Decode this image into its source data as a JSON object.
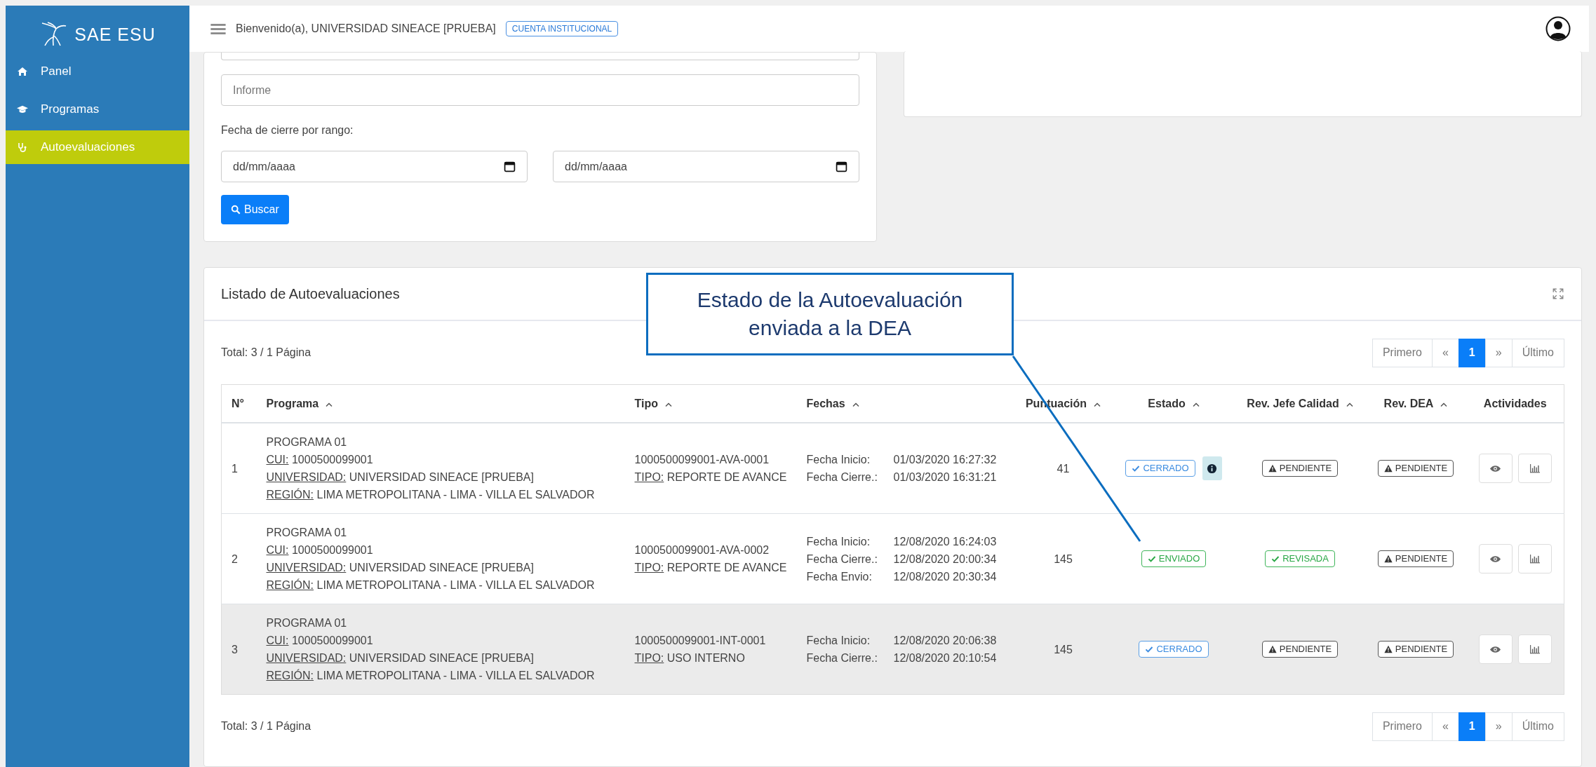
{
  "sidebar": {
    "logo": "SAE ESU",
    "items": [
      {
        "label": "Panel",
        "selected": false
      },
      {
        "label": "Programas",
        "selected": false
      },
      {
        "label": "Autoevaluaciones",
        "selected": true
      }
    ]
  },
  "header": {
    "welcome": "Bienvenido(a), UNIVERSIDAD SINEACE [PRUEBA]",
    "badge": "CUENTA INSTITUCIONAL"
  },
  "filters": {
    "informe_placeholder": "Informe",
    "range_label": "Fecha de cierre por rango:",
    "date_from_placeholder": "dd/mm/aaaa",
    "date_to_placeholder": "dd/mm/aaaa",
    "search_button": "Buscar"
  },
  "listing": {
    "title": "Listado de Autoevaluaciones",
    "total_top": "Total: 3 / 1 Página",
    "total_bottom": "Total: 3 / 1 Página",
    "pagination_top": [
      {
        "label": "Primero",
        "selected": false
      },
      {
        "label": "«",
        "selected": false
      },
      {
        "label": "1",
        "selected": true
      },
      {
        "label": "»",
        "selected": false
      },
      {
        "label": "Último",
        "selected": false
      }
    ],
    "pagination_bottom": [
      {
        "label": "Primero",
        "selected": false
      },
      {
        "label": "«",
        "selected": false
      },
      {
        "label": "1",
        "selected": true
      },
      {
        "label": "»",
        "selected": false
      },
      {
        "label": "Último",
        "selected": false
      }
    ],
    "columns": [
      {
        "label": "N°",
        "sortable": false
      },
      {
        "label": "Programa",
        "sortable": true
      },
      {
        "label": "Tipo",
        "sortable": true
      },
      {
        "label": "Fechas",
        "sortable": true
      },
      {
        "label": "Puntuación",
        "sortable": true
      },
      {
        "label": "Estado",
        "sortable": true
      },
      {
        "label": "Rev. Jefe Calidad",
        "sortable": true
      },
      {
        "label": "Rev. DEA",
        "sortable": true
      },
      {
        "label": "Actividades",
        "sortable": false
      }
    ],
    "rows": [
      {
        "n": "1",
        "programa": "PROGRAMA 01",
        "cui_label": "CUI:",
        "cui": "1000500099001",
        "univ_label": "UNIVERSIDAD:",
        "univ": "UNIVERSIDAD SINEACE [PRUEBA]",
        "region_label": "REGIÓN:",
        "region": "LIMA METROPOLITANA - LIMA - VILLA EL SALVADOR",
        "codigo": "1000500099001-AVA-0001",
        "tipo_label": "TIPO:",
        "tipo": "REPORTE DE AVANCE",
        "fechas": [
          {
            "label": "Fecha Inicio:",
            "value": "01/03/2020 16:27:32"
          },
          {
            "label": "Fecha Cierre.:",
            "value": "01/03/2020 16:31:21"
          }
        ],
        "puntuacion": "41",
        "estado": {
          "kind": "closed",
          "label": "CERRADO"
        },
        "info": true,
        "rev_jefe": {
          "kind": "pending",
          "label": "PENDIENTE"
        },
        "rev_dea": {
          "kind": "pending",
          "label": "PENDIENTE"
        },
        "selected": false
      },
      {
        "n": "2",
        "programa": "PROGRAMA 01",
        "cui_label": "CUI:",
        "cui": "1000500099001",
        "univ_label": "UNIVERSIDAD:",
        "univ": "UNIVERSIDAD SINEACE [PRUEBA]",
        "region_label": "REGIÓN:",
        "region": "LIMA METROPOLITANA - LIMA - VILLA EL SALVADOR",
        "codigo": "1000500099001-AVA-0002",
        "tipo_label": "TIPO:",
        "tipo": "REPORTE DE AVANCE",
        "fechas": [
          {
            "label": "Fecha Inicio:",
            "value": "12/08/2020 16:24:03"
          },
          {
            "label": "Fecha Cierre.:",
            "value": "12/08/2020 20:00:34"
          },
          {
            "label": "Fecha Envio:",
            "value": "12/08/2020 20:30:34"
          }
        ],
        "puntuacion": "145",
        "estado": {
          "kind": "done",
          "label": "ENVIADO"
        },
        "info": false,
        "rev_jefe": {
          "kind": "done",
          "label": "REVISADA"
        },
        "rev_dea": {
          "kind": "pending",
          "label": "PENDIENTE"
        },
        "selected": false
      },
      {
        "n": "3",
        "programa": "PROGRAMA 01",
        "cui_label": "CUI:",
        "cui": "1000500099001",
        "univ_label": "UNIVERSIDAD:",
        "univ": "UNIVERSIDAD SINEACE [PRUEBA]",
        "region_label": "REGIÓN:",
        "region": "LIMA METROPOLITANA - LIMA - VILLA EL SALVADOR",
        "codigo": "1000500099001-INT-0001",
        "tipo_label": "TIPO:",
        "tipo": "USO INTERNO",
        "fechas": [
          {
            "label": "Fecha Inicio:",
            "value": "12/08/2020 20:06:38"
          },
          {
            "label": "Fecha Cierre.:",
            "value": "12/08/2020 20:10:54"
          }
        ],
        "puntuacion": "145",
        "estado": {
          "kind": "closed",
          "label": "CERRADO"
        },
        "info": false,
        "rev_jefe": {
          "kind": "pending",
          "label": "PENDIENTE"
        },
        "rev_dea": {
          "kind": "pending",
          "label": "PENDIENTE"
        },
        "selected": true
      }
    ]
  },
  "callout": {
    "text": "Estado de la Autoevaluación enviada a la DEA"
  }
}
